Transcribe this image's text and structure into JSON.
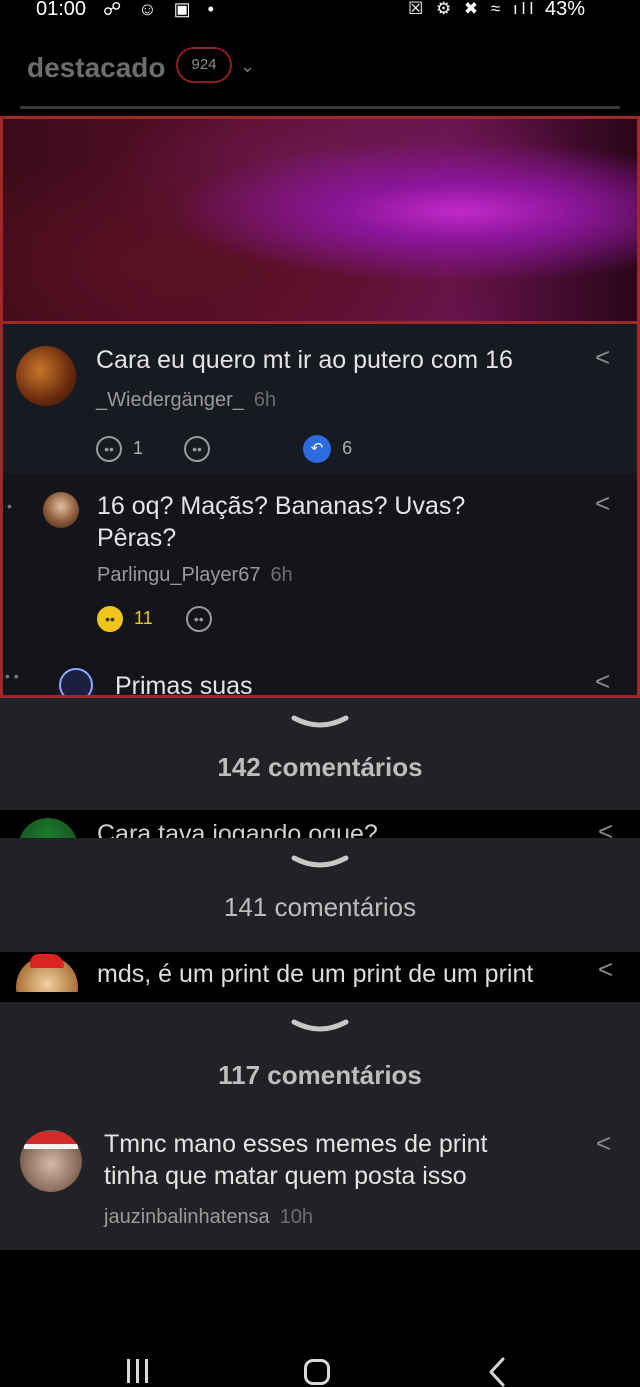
{
  "status_bar": {
    "time": "01:00",
    "battery": "43%"
  },
  "header": {
    "title": "destacado",
    "badge": "924"
  },
  "thread": [
    {
      "text": "Cara eu quero mt ir ao putero com 16",
      "user": "_Wiedergänger_",
      "time": "6h",
      "likes": "1",
      "replies": "6"
    },
    {
      "text_line1": "16 oq? Maçãs? Bananas? Uvas?",
      "text_line2": "Pêras?",
      "user": "Parlingu_Player67",
      "time": "6h",
      "likes": "11"
    },
    {
      "text": "Primas suas"
    }
  ],
  "panels": [
    {
      "count": "142 comentários",
      "next_preview": "Cara tava jogando oque?"
    },
    {
      "count": "141 comentários",
      "next_preview": "mds, é um print de um print de um print"
    },
    {
      "count": "117 comentários"
    }
  ],
  "last_comment": {
    "line1": "Tmnc mano esses memes de print",
    "line2": "tinha que matar quem posta isso",
    "user": "jauzinbalinhatensa",
    "time": "10h"
  }
}
